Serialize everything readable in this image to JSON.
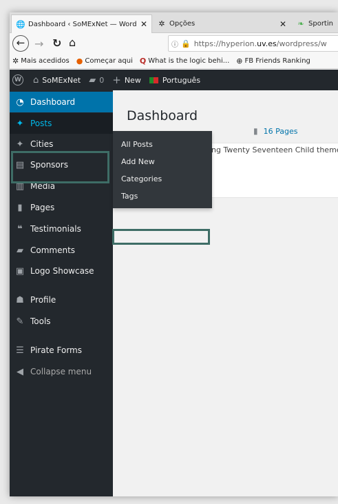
{
  "browser": {
    "tabs": [
      {
        "label": "Dashboard ‹ SoMExNet — Word",
        "icon": "globe-icon",
        "close": "✕",
        "active": true
      },
      {
        "label": "Opções",
        "icon": "gear-icon",
        "close": "✕",
        "active": false
      },
      {
        "label": "Sportin",
        "icon": "leaf-icon",
        "close": "",
        "active": false
      }
    ],
    "url": {
      "prefix": "https://hyperion.",
      "host": "uv.es",
      "path": "/wordpress/w"
    },
    "bookmarks": [
      {
        "label": "Mais acedidos",
        "icon": "gear-icon"
      },
      {
        "label": "Começar aqui",
        "icon": "firefox-icon"
      },
      {
        "label": "What is the logic behi...",
        "icon": "q-icon"
      },
      {
        "label": "FB Friends Ranking",
        "icon": "globe-icon"
      }
    ]
  },
  "adminbar": {
    "site_name": "SoMExNet",
    "comments_count": "0",
    "new_label": "New",
    "language": "Português"
  },
  "sidebar": {
    "items": [
      {
        "label": "Dashboard",
        "icon": "dashboard-icon"
      },
      {
        "label": "Posts",
        "icon": "pin-icon"
      },
      {
        "label": "Cities",
        "icon": "pin-icon"
      },
      {
        "label": "Sponsors",
        "icon": "media-icon"
      },
      {
        "label": "Media",
        "icon": "media-icon"
      },
      {
        "label": "Pages",
        "icon": "page-icon"
      },
      {
        "label": "Testimonials",
        "icon": "quote-icon"
      },
      {
        "label": "Comments",
        "icon": "comment-icon"
      },
      {
        "label": "Logo Showcase",
        "icon": "image-icon"
      },
      {
        "label": "Profile",
        "icon": "user-icon"
      },
      {
        "label": "Tools",
        "icon": "wrench-icon"
      },
      {
        "label": "Pirate Forms",
        "icon": "form-icon"
      },
      {
        "label": "Collapse menu",
        "icon": "collapse-icon"
      }
    ],
    "posts_submenu": [
      "All Posts",
      "Add New",
      "Categories",
      "Tags"
    ]
  },
  "main": {
    "title": "Dashboard",
    "pages_count": "16 Pages",
    "theme_text": "ing Twenty Seventeen Child theme."
  },
  "colors": {
    "admin_dark": "#23282d",
    "wp_blue": "#0073aa",
    "highlight_box": "#3e6d66"
  }
}
